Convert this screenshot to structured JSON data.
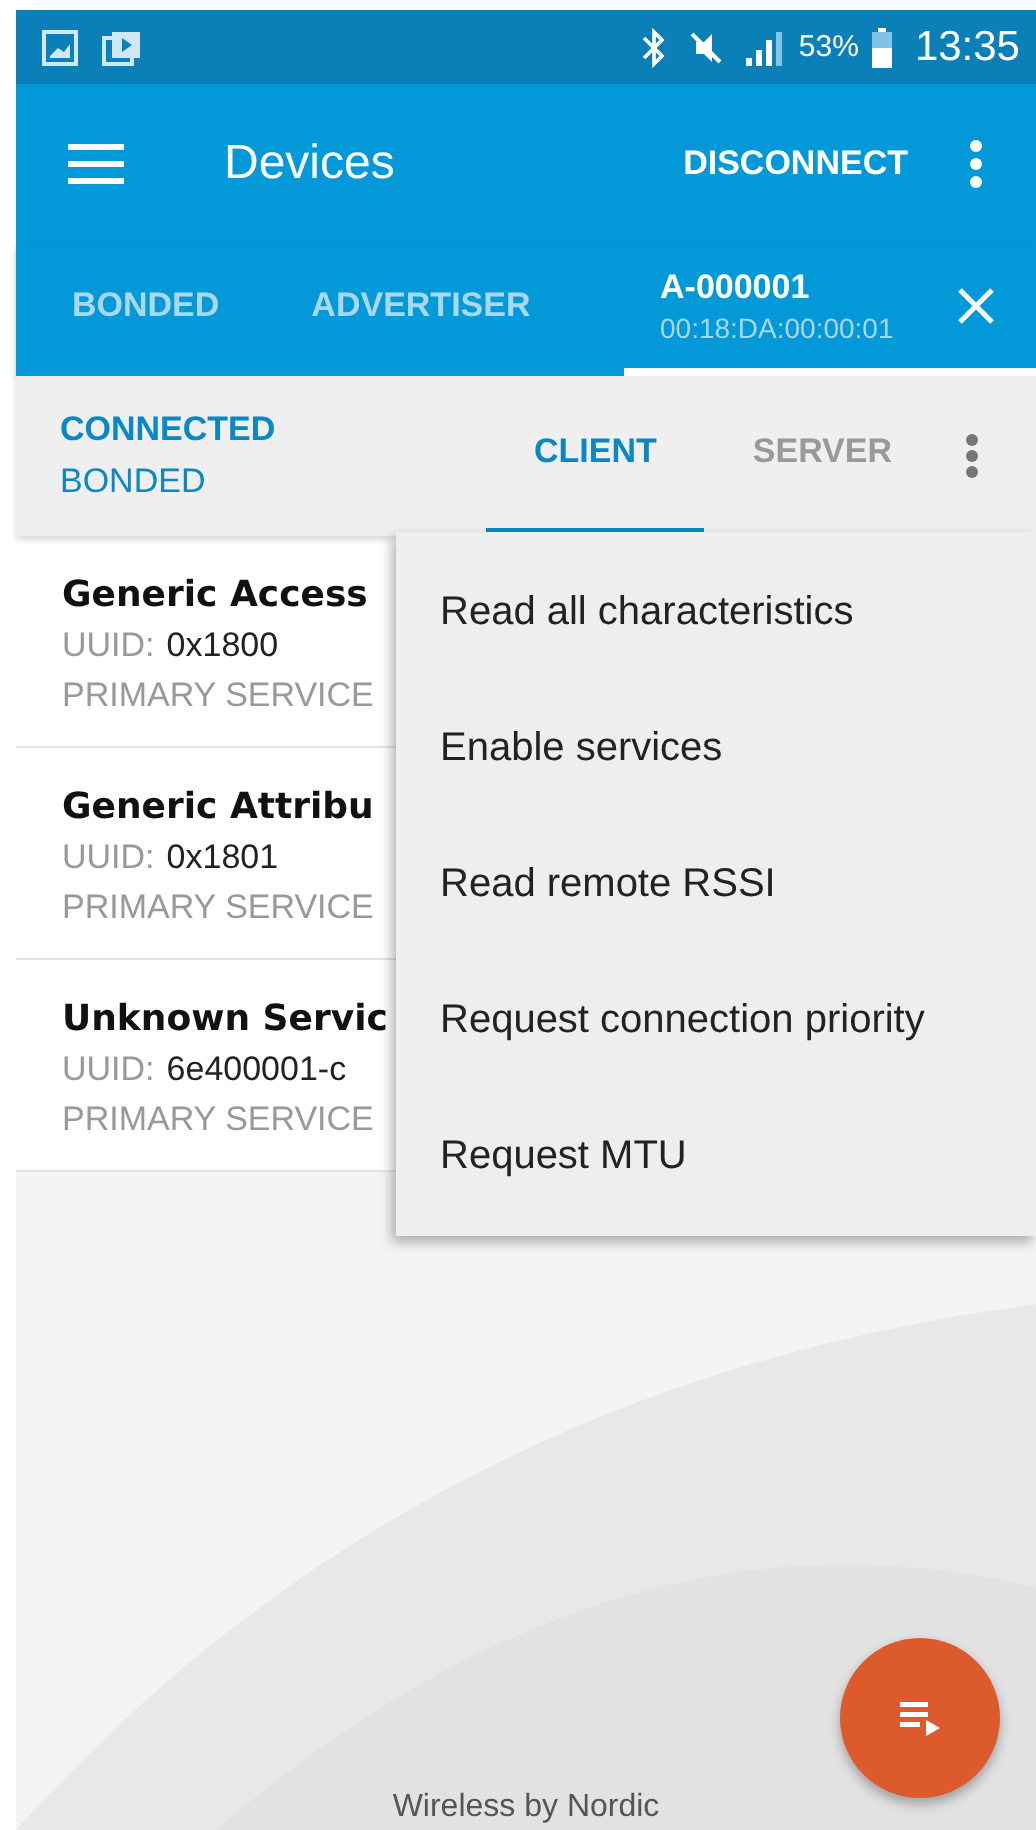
{
  "status_bar": {
    "battery_text": "53%",
    "time": "13:35"
  },
  "app_bar": {
    "title": "Devices",
    "action": "DISCONNECT"
  },
  "device_tabs": [
    {
      "kind": "plain",
      "label": "BONDED",
      "selected": false
    },
    {
      "kind": "plain",
      "label": "ADVERTISER",
      "selected": false
    },
    {
      "kind": "device",
      "label": "A-000001",
      "address": "00:18:DA:00:00:01",
      "selected": true
    }
  ],
  "connection": {
    "state": "CONNECTED",
    "bond": "BONDED"
  },
  "role_tabs": [
    {
      "label": "CLIENT",
      "selected": true
    },
    {
      "label": "SERVER",
      "selected": false
    }
  ],
  "services": [
    {
      "name": "Generic Access",
      "uuid_label": "UUID:",
      "uuid": "0x1800",
      "type": "PRIMARY SERVICE"
    },
    {
      "name": "Generic Attribu",
      "uuid_label": "UUID:",
      "uuid": "0x1801",
      "type": "PRIMARY SERVICE"
    },
    {
      "name": "Unknown Servic",
      "uuid_label": "UUID:",
      "uuid": "6e400001-c",
      "type": "PRIMARY SERVICE"
    }
  ],
  "menu": [
    "Read all characteristics",
    "Enable services",
    "Read remote RSSI",
    "Request connection priority",
    "Request MTU"
  ],
  "footer": "Wireless by Nordic"
}
